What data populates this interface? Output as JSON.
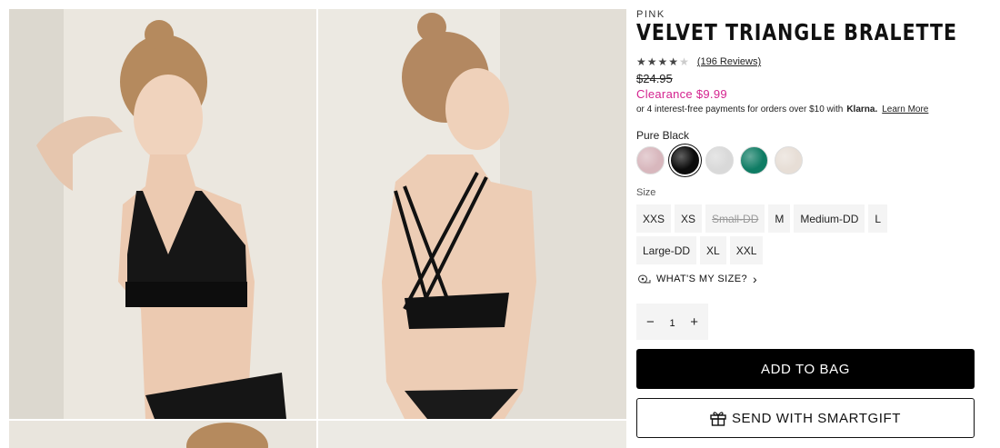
{
  "product": {
    "brand": "PINK",
    "title": "VELVET TRIANGLE BRALETTE",
    "rating": 4,
    "rating_max": 5,
    "reviews_label": "(196 Reviews)",
    "original_price": "$24.95",
    "sale_price": "Clearance $9.99",
    "klarna_text": "or 4 interest-free payments for orders over $10 with",
    "klarna_brand": "Klarna.",
    "learn_more": "Learn More"
  },
  "color": {
    "selected_name": "Pure Black",
    "swatches": [
      {
        "name": "pink-velvet",
        "hex": "#d8b7bd",
        "selected": false
      },
      {
        "name": "pure-black",
        "hex": "#0c0c0c",
        "selected": true
      },
      {
        "name": "silver-velvet",
        "hex": "#d9d9d9",
        "selected": false
      },
      {
        "name": "emerald-velvet",
        "hex": "#0f7c64",
        "selected": false
      },
      {
        "name": "champagne-velvet",
        "hex": "#e7ded6",
        "selected": false
      }
    ]
  },
  "size": {
    "label": "Size",
    "row1": [
      {
        "label": "XXS",
        "available": true
      },
      {
        "label": "XS",
        "available": true
      },
      {
        "label": "Small-DD",
        "available": false
      },
      {
        "label": "M",
        "available": true
      },
      {
        "label": "Medium-DD",
        "available": true
      },
      {
        "label": "L",
        "available": true
      }
    ],
    "row2": [
      {
        "label": "Large-DD",
        "available": true
      },
      {
        "label": "XL",
        "available": true
      },
      {
        "label": "XXL",
        "available": true
      }
    ],
    "whats_my_size": "WHAT'S MY SIZE?"
  },
  "quantity": {
    "value": "1",
    "minus": "−",
    "plus": "+"
  },
  "actions": {
    "add_to_bag": "ADD TO BAG",
    "smartgift": "SEND WITH SMARTGIFT"
  },
  "icons": {
    "star": "★",
    "chevron": "›"
  },
  "colors": {
    "sale": "#d4238f",
    "button_primary": "#000000"
  }
}
